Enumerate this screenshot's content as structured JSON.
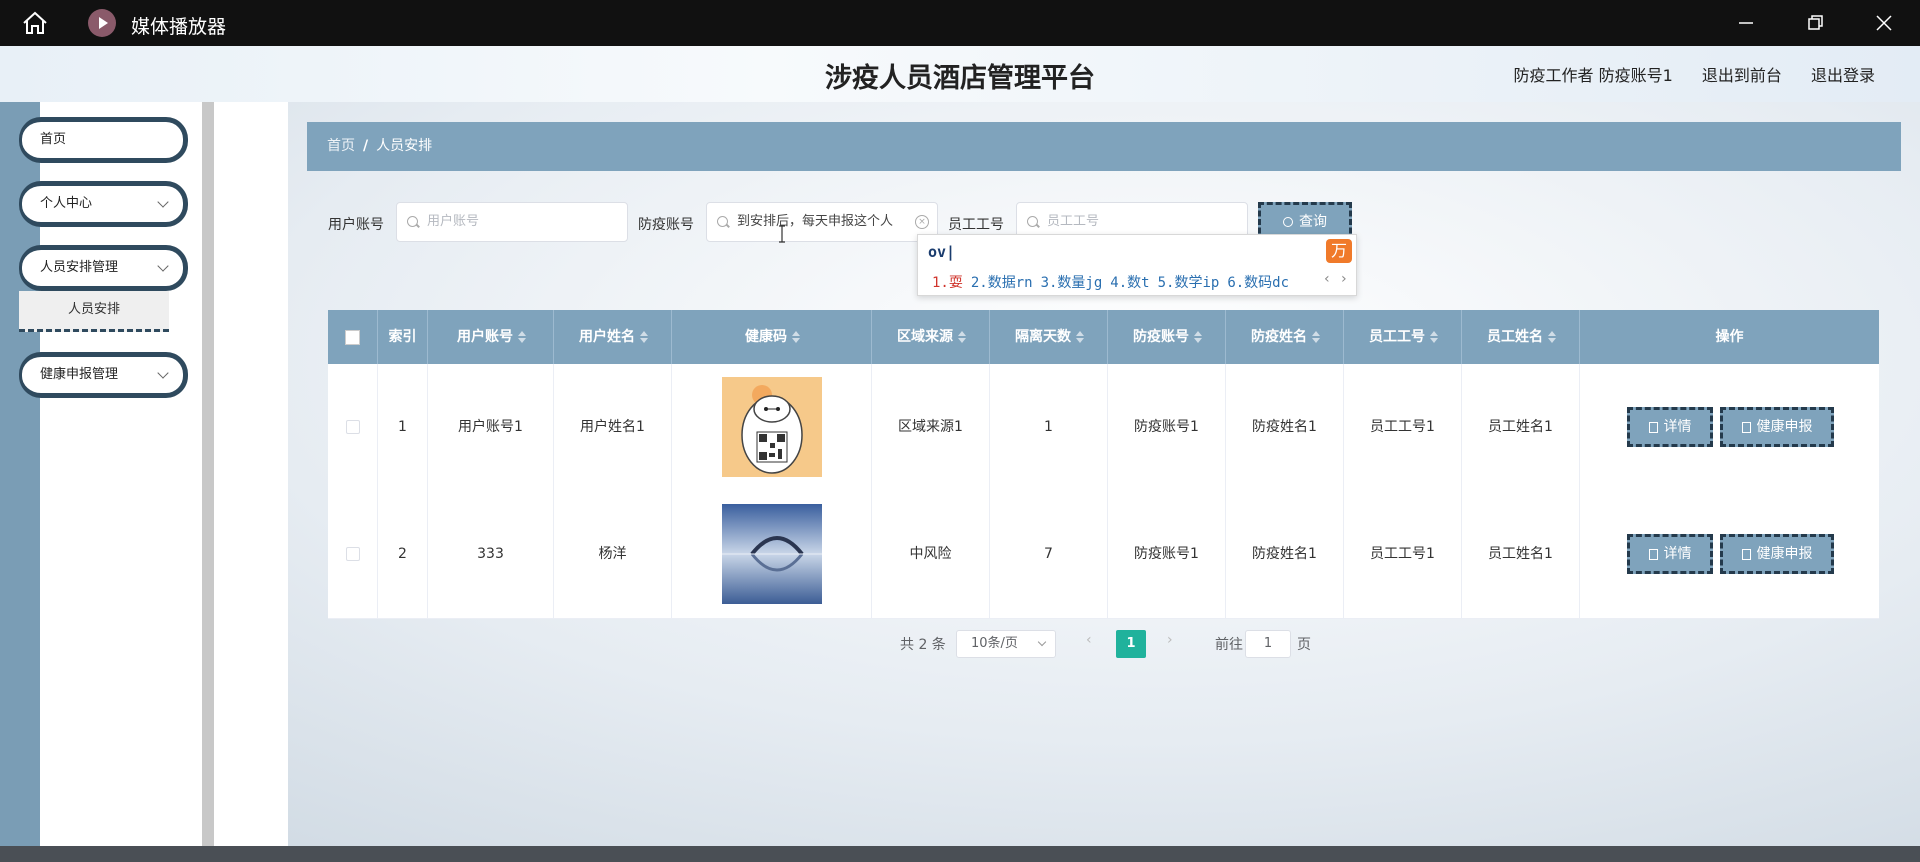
{
  "window": {
    "title": "媒体播放器"
  },
  "header": {
    "title": "涉疫人员酒店管理平台",
    "user": "防疫工作者 防疫账号1",
    "front_link": "退出到前台",
    "logout": "退出登录"
  },
  "sidebar": {
    "items": [
      {
        "label": "首页"
      },
      {
        "label": "个人中心"
      },
      {
        "label": "人员安排管理"
      },
      {
        "label": "健康申报管理"
      }
    ],
    "submenu_label": "人员安排"
  },
  "breadcrumb": {
    "home": "首页",
    "separator": "/",
    "current": "人员安排"
  },
  "search": {
    "user_account_label": "用户账号",
    "user_account_placeholder": "用户账号",
    "epi_account_label": "防疫账号",
    "epi_account_value": "到安排后，每天申报这个人",
    "staff_id_label": "员工工号",
    "staff_id_placeholder": "员工工号",
    "query_label": "查询"
  },
  "ime": {
    "code": "ov|",
    "candidates": [
      "1.耍",
      "2.数据rn",
      "3.数量jg",
      "4.数t",
      "5.数学ip",
      "6.数码dc"
    ],
    "logo_glyph": "万",
    "nav": "‹ ›"
  },
  "table": {
    "headers": [
      "索引",
      "用户账号",
      "用户姓名",
      "健康码",
      "区域来源",
      "隔离天数",
      "防疫账号",
      "防疫姓名",
      "员工工号",
      "员工姓名",
      "操作"
    ],
    "rows": [
      {
        "index": "1",
        "user_account": "用户账号1",
        "user_name": "用户姓名1",
        "region": "区域来源1",
        "days": "1",
        "epi_account": "防疫账号1",
        "epi_name": "防疫姓名1",
        "staff_id": "员工工号1",
        "staff_name": "员工姓名1"
      },
      {
        "index": "2",
        "user_account": "333",
        "user_name": "杨洋",
        "region": "中风险",
        "days": "7",
        "epi_account": "防疫账号1",
        "epi_name": "防疫姓名1",
        "staff_id": "员工工号1",
        "staff_name": "员工姓名1"
      }
    ],
    "detail_label": "详情",
    "health_label": "健康申报"
  },
  "pagination": {
    "total": "共 2 条",
    "page_size": "10条/页",
    "current_page": "1",
    "goto_label": "前往",
    "goto_value": "1",
    "page_suffix": "页"
  },
  "colors": {
    "accent": "#7fa3bc",
    "dark": "#2f4a5e",
    "active_page": "#20b29c"
  }
}
